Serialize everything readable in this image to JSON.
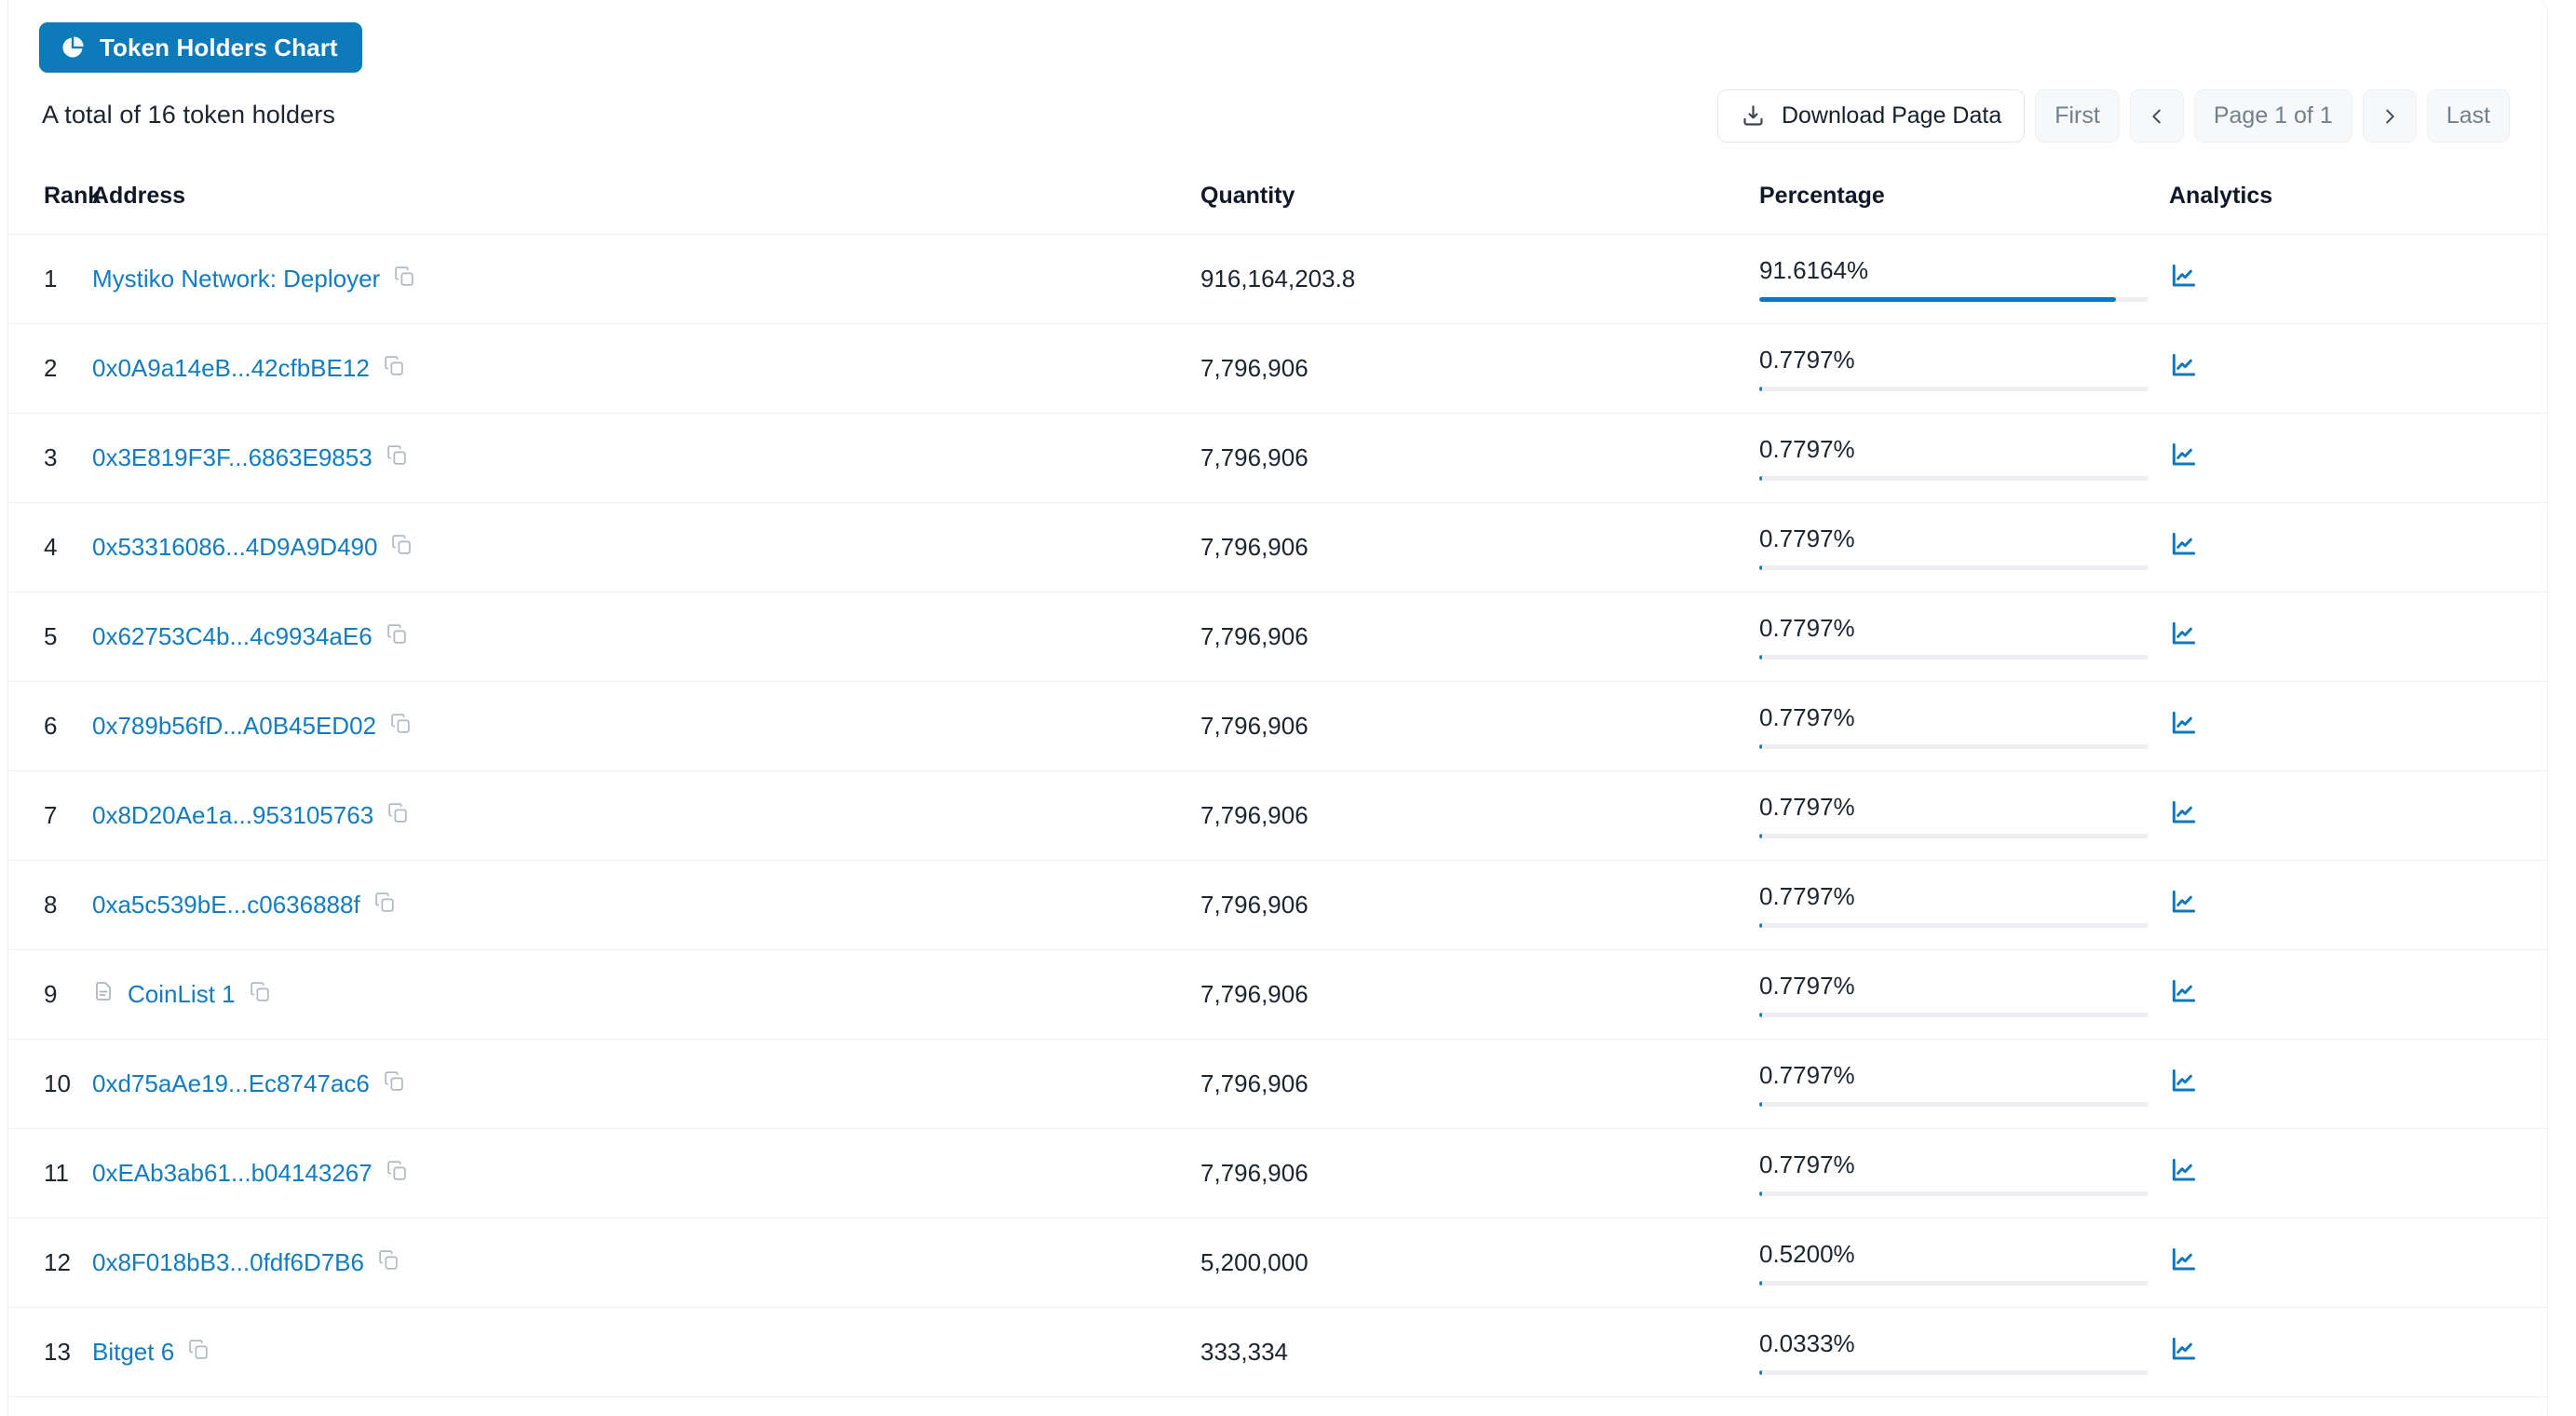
{
  "header": {
    "chart_button_label": "Token Holders Chart",
    "chart_button_icon": "pie-chart-icon",
    "total_text": "A total of 16 token holders",
    "total_holders": 16
  },
  "toolbar": {
    "download_label": "Download Page Data",
    "download_icon": "download-icon",
    "first_label": "First",
    "prev_icon": "chevron-left-icon",
    "page_label": "Page 1 of 1",
    "next_icon": "chevron-right-icon",
    "last_label": "Last",
    "current_page": 1,
    "total_pages": 1
  },
  "table": {
    "columns": [
      "Rank",
      "Address",
      "Quantity",
      "Percentage",
      "Analytics"
    ],
    "rows": [
      {
        "rank": "1",
        "address": "Mystiko Network: Deployer",
        "is_named": true,
        "has_doc_icon": false,
        "quantity": "916,164,203.8",
        "percentage": "91.6164%",
        "pct_value": 91.6164
      },
      {
        "rank": "2",
        "address": "0x0A9a14eB...42cfbBE12",
        "is_named": false,
        "has_doc_icon": false,
        "quantity": "7,796,906",
        "percentage": "0.7797%",
        "pct_value": 0.7797
      },
      {
        "rank": "3",
        "address": "0x3E819F3F...6863E9853",
        "is_named": false,
        "has_doc_icon": false,
        "quantity": "7,796,906",
        "percentage": "0.7797%",
        "pct_value": 0.7797
      },
      {
        "rank": "4",
        "address": "0x53316086...4D9A9D490",
        "is_named": false,
        "has_doc_icon": false,
        "quantity": "7,796,906",
        "percentage": "0.7797%",
        "pct_value": 0.7797
      },
      {
        "rank": "5",
        "address": "0x62753C4b...4c9934aE6",
        "is_named": false,
        "has_doc_icon": false,
        "quantity": "7,796,906",
        "percentage": "0.7797%",
        "pct_value": 0.7797
      },
      {
        "rank": "6",
        "address": "0x789b56fD...A0B45ED02",
        "is_named": false,
        "has_doc_icon": false,
        "quantity": "7,796,906",
        "percentage": "0.7797%",
        "pct_value": 0.7797
      },
      {
        "rank": "7",
        "address": "0x8D20Ae1a...953105763",
        "is_named": false,
        "has_doc_icon": false,
        "quantity": "7,796,906",
        "percentage": "0.7797%",
        "pct_value": 0.7797
      },
      {
        "rank": "8",
        "address": "0xa5c539bE...c0636888f",
        "is_named": false,
        "has_doc_icon": false,
        "quantity": "7,796,906",
        "percentage": "0.7797%",
        "pct_value": 0.7797
      },
      {
        "rank": "9",
        "address": "CoinList 1",
        "is_named": true,
        "has_doc_icon": true,
        "quantity": "7,796,906",
        "percentage": "0.7797%",
        "pct_value": 0.7797
      },
      {
        "rank": "10",
        "address": "0xd75aAe19...Ec8747ac6",
        "is_named": false,
        "has_doc_icon": false,
        "quantity": "7,796,906",
        "percentage": "0.7797%",
        "pct_value": 0.7797
      },
      {
        "rank": "11",
        "address": "0xEAb3ab61...b04143267",
        "is_named": false,
        "has_doc_icon": false,
        "quantity": "7,796,906",
        "percentage": "0.7797%",
        "pct_value": 0.7797
      },
      {
        "rank": "12",
        "address": "0x8F018bB3...0fdf6D7B6",
        "is_named": false,
        "has_doc_icon": false,
        "quantity": "5,200,000",
        "percentage": "0.5200%",
        "pct_value": 0.52
      },
      {
        "rank": "13",
        "address": "Bitget 6",
        "is_named": true,
        "has_doc_icon": false,
        "quantity": "333,334",
        "percentage": "0.0333%",
        "pct_value": 0.0333
      }
    ],
    "row_icons": {
      "copy": "copy-icon",
      "analytics": "analytics-chart-icon",
      "contract": "document-icon"
    }
  },
  "colors": {
    "accent": "#0d7ab9",
    "link": "#127cc1",
    "bar_fill": "#1177bd",
    "bar_track": "#edeff2",
    "text": "#1c2430",
    "muted": "#737f8c",
    "border": "#eef0f3"
  }
}
